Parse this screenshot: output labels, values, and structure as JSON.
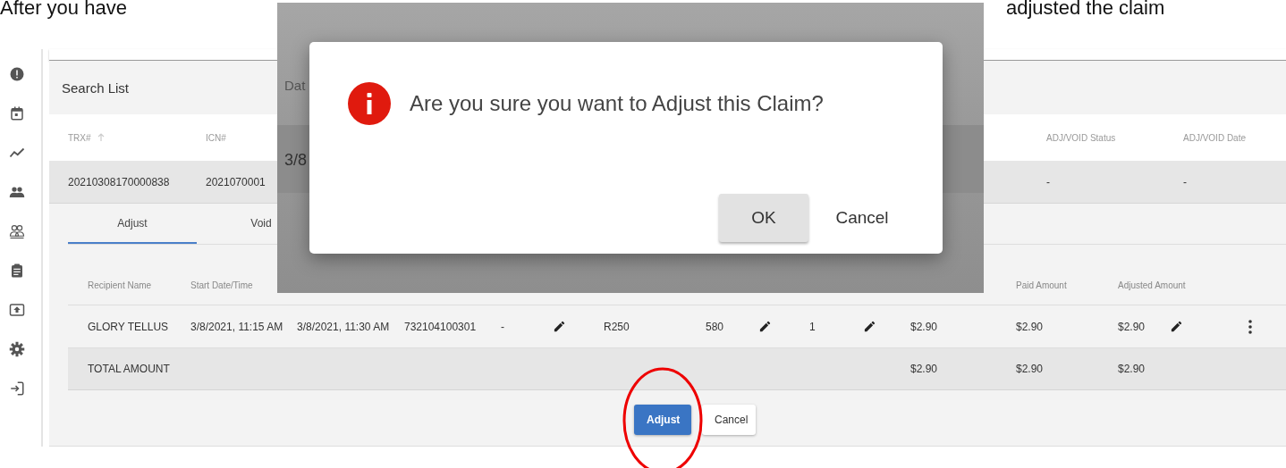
{
  "caption": {
    "left": "After you have",
    "right": "adjusted the claim"
  },
  "search_list": {
    "title": "Search List",
    "columns": [
      {
        "label": "TRX#",
        "sorted": true
      },
      {
        "label": "ICN#",
        "sorted": false
      },
      {
        "label": "ADJ/VOID Status",
        "sorted": false
      },
      {
        "label": "ADJ/VOID Date",
        "sorted": false
      }
    ],
    "row": [
      "20210308170000838",
      "2021070001",
      "-",
      "-"
    ]
  },
  "tabs": [
    {
      "label": "Adjust",
      "selected": true
    },
    {
      "label": "Void",
      "selected": false
    }
  ],
  "detail_table": {
    "columns": [
      "Recipient Name",
      "Start Date/Time",
      "Paid Amount",
      "Adjusted Amount"
    ],
    "row": [
      {
        "kind": "text",
        "text": "GLORY TELLUS"
      },
      {
        "kind": "text",
        "text": "3/8/2021, 11:15 AM"
      },
      {
        "kind": "text",
        "text": "3/8/2021, 11:30 AM"
      },
      {
        "kind": "text",
        "text": "732104100301"
      },
      {
        "kind": "text",
        "text": "-"
      },
      {
        "kind": "edit"
      },
      {
        "kind": "text",
        "text": "R250"
      },
      {
        "kind": "text",
        "text": "580"
      },
      {
        "kind": "edit"
      },
      {
        "kind": "text",
        "text": "1"
      },
      {
        "kind": "edit"
      },
      {
        "kind": "text",
        "text": "$2.90"
      },
      {
        "kind": "text",
        "text": "$2.90"
      },
      {
        "kind": "text",
        "text": "$2.90"
      },
      {
        "kind": "edit"
      },
      {
        "kind": "menu"
      }
    ],
    "total": {
      "label": "TOTAL AMOUNT",
      "amounts": [
        "$2.90",
        "$2.90",
        "$2.90"
      ]
    }
  },
  "actions": [
    {
      "label": "Adjust",
      "kind": "primary"
    },
    {
      "label": "Cancel",
      "kind": "secondary"
    }
  ],
  "dialog_backdrop": {
    "texts": [
      "Dat",
      "3/8"
    ]
  },
  "dialog": {
    "message": "Are you sure you want to Adjust this Claim?",
    "buttons": [
      {
        "label": "OK",
        "focused": true
      },
      {
        "label": "Cancel",
        "focused": false
      }
    ]
  }
}
